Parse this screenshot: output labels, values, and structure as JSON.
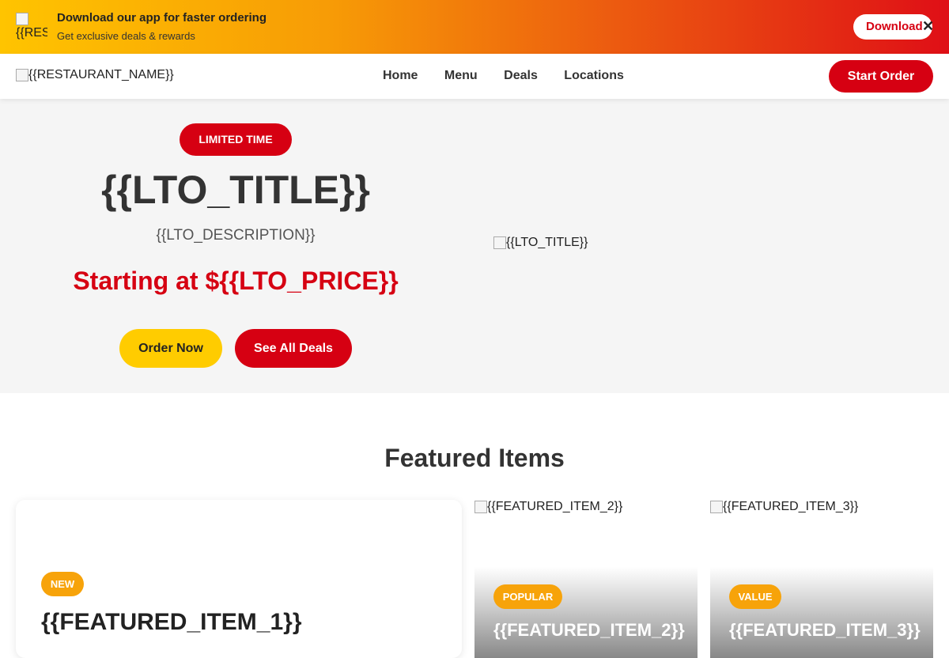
{
  "promo": {
    "app_icon_alt": "{{RES",
    "title": "Download our app for faster ordering",
    "subtitle": "Get exclusive deals & rewards",
    "download_label": "Download",
    "close_label": "✕"
  },
  "nav": {
    "logo_alt": "{{RESTAURANT_NAME}}",
    "links": [
      "Home",
      "Menu",
      "Deals",
      "Locations"
    ],
    "start_order_label": "Start Order"
  },
  "hero": {
    "badge": "LIMITED TIME",
    "title": "{{LTO_TITLE}}",
    "description": "{{LTO_DESCRIPTION}}",
    "price": "Starting at ${{LTO_PRICE}}",
    "order_now_label": "Order Now",
    "see_all_deals_label": "See All Deals",
    "image_alt": "{{LTO_TITLE}}"
  },
  "featured": {
    "heading": "Featured Items",
    "items": [
      {
        "badge": "NEW",
        "name": "{{FEATURED_ITEM_1}}"
      },
      {
        "badge": "POPULAR",
        "name": "{{FEATURED_ITEM_2}}",
        "image_alt": "{{FEATURED_ITEM_2}}"
      },
      {
        "badge": "VALUE",
        "name": "{{FEATURED_ITEM_3}}",
        "image_alt": "{{FEATURED_ITEM_3}}"
      }
    ]
  },
  "colors": {
    "brand_red": "#d60012",
    "accent_yellow": "#ffcc00",
    "badge_orange": "#f7a30a"
  }
}
